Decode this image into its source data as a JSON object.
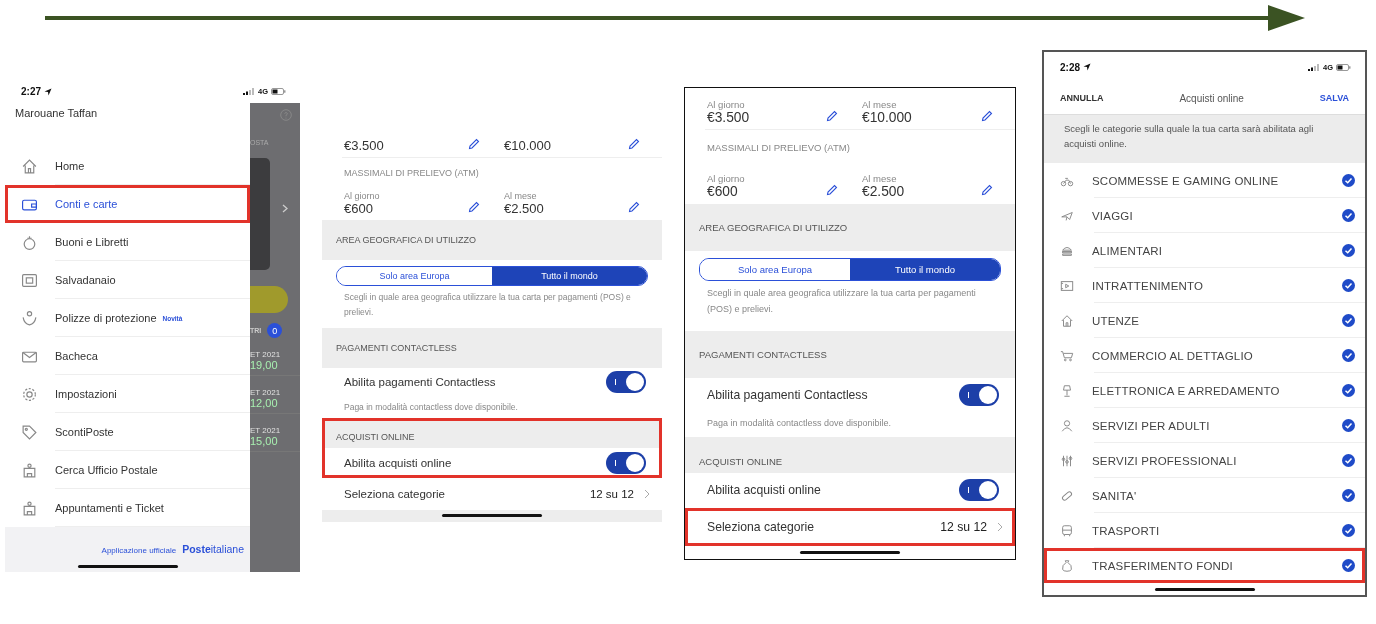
{
  "panels": [
    {
      "kind": "menu",
      "status_bar": {
        "time": "2:27",
        "network": "4G"
      },
      "user_name": "Marouane Taffan",
      "items": [
        {
          "label": "Home",
          "selected": false,
          "highlighted": false
        },
        {
          "label": "Conti e carte",
          "selected": true,
          "highlighted": true
        },
        {
          "label": "Buoni e Libretti",
          "selected": false,
          "highlighted": false
        },
        {
          "label": "Salvadanaio",
          "selected": false,
          "highlighted": false
        },
        {
          "label": "Polizze di protezione",
          "badge": "Novità",
          "selected": false,
          "highlighted": false
        },
        {
          "label": "Bacheca",
          "selected": false,
          "highlighted": false
        },
        {
          "label": "Impostazioni",
          "selected": false,
          "highlighted": false
        },
        {
          "label": "ScontiPoste",
          "selected": false,
          "highlighted": false
        },
        {
          "label": "Cerca Ufficio Postale",
          "selected": false,
          "highlighted": false
        },
        {
          "label": "Appuntamenti e Ticket",
          "selected": false,
          "highlighted": false
        }
      ],
      "footer": {
        "caption": "Applicazione ufficiale",
        "brand": "**Poste**italiane"
      },
      "background": {
        "tab": "OSTA",
        "filter": "TRI",
        "counter": "0",
        "entries": [
          {
            "date": "ET 2021",
            "amount": "19,00"
          },
          {
            "date": "ET 2021",
            "amount": "12,00"
          },
          {
            "date": "ET 2021",
            "amount": "15,00"
          }
        ]
      }
    },
    {
      "kind": "settings",
      "rows": [
        {
          "kind": "limits",
          "highlighted": false,
          "cells": [
            {
              "value": "€3.500"
            },
            {
              "value": "€10.000"
            }
          ]
        },
        {
          "kind": "caption",
          "highlighted": false,
          "text": "MASSIMALI DI PRELIEVO (ATM)"
        },
        {
          "kind": "limits",
          "highlighted": false,
          "cells": [
            {
              "label": "Al giorno",
              "value": "€600"
            },
            {
              "label": "Al mese",
              "value": "€2.500"
            }
          ]
        },
        {
          "kind": "header",
          "highlighted": false,
          "text": "AREA GEOGRAFICA DI UTILIZZO"
        },
        {
          "kind": "segmented",
          "highlighted": false,
          "options": [
            {
              "label": "Solo area Europa",
              "selected": false
            },
            {
              "label": "Tutto il mondo",
              "selected": true
            }
          ]
        },
        {
          "kind": "note",
          "highlighted": false,
          "text": "Scegli in quale area geografica utilizzare la tua carta per pagamenti (POS) e prelievi."
        },
        {
          "kind": "header",
          "highlighted": false,
          "text": "PAGAMENTI CONTACTLESS"
        },
        {
          "kind": "toggle",
          "highlighted": false,
          "label": "Abilita pagamenti Contactless",
          "on": true
        },
        {
          "kind": "note",
          "highlighted": false,
          "text": "Paga in modalità contactless dove disponibile."
        },
        {
          "kind": "header",
          "highlighted": true,
          "text": "ACQUISTI ONLINE"
        },
        {
          "kind": "toggle",
          "highlighted": true,
          "label": "Abilita acquisti online",
          "on": true
        },
        {
          "kind": "link",
          "highlighted": false,
          "label": "Seleziona categorie",
          "value": "12 su 12"
        }
      ]
    },
    {
      "kind": "settings",
      "rows": [
        {
          "kind": "limits",
          "highlighted": false,
          "cells": [
            {
              "label": "Al giorno",
              "value": "€3.500"
            },
            {
              "label": "Al mese",
              "value": "€10.000"
            }
          ]
        },
        {
          "kind": "caption",
          "highlighted": false,
          "text": "MASSIMALI DI PRELIEVO (ATM)"
        },
        {
          "kind": "limits",
          "highlighted": false,
          "cells": [
            {
              "label": "Al giorno",
              "value": "€600"
            },
            {
              "label": "Al mese",
              "value": "€2.500"
            }
          ]
        },
        {
          "kind": "header",
          "highlighted": false,
          "text": "AREA GEOGRAFICA DI UTILIZZO"
        },
        {
          "kind": "segmented",
          "highlighted": false,
          "options": [
            {
              "label": "Solo area Europa",
              "selected": false
            },
            {
              "label": "Tutto il mondo",
              "selected": true
            }
          ]
        },
        {
          "kind": "note",
          "highlighted": false,
          "text": "Scegli in quale area geografica utilizzare la tua carta per pagamenti (POS) e prelievi."
        },
        {
          "kind": "header",
          "highlighted": false,
          "text": "PAGAMENTI CONTACTLESS"
        },
        {
          "kind": "toggle",
          "highlighted": false,
          "label": "Abilita pagamenti Contactless",
          "on": true
        },
        {
          "kind": "note",
          "highlighted": false,
          "text": "Paga in modalità contactless dove disponibile."
        },
        {
          "kind": "header",
          "highlighted": false,
          "text": "ACQUISTI ONLINE"
        },
        {
          "kind": "toggle",
          "highlighted": false,
          "label": "Abilita acquisti online",
          "on": true
        },
        {
          "kind": "link",
          "highlighted": true,
          "label": "Seleziona categorie",
          "value": "12 su 12"
        }
      ]
    },
    {
      "kind": "categories",
      "status_bar": {
        "time": "2:28",
        "network": "4G"
      },
      "header": {
        "cancel": "ANNULLA",
        "title": "Acquisti online",
        "save": "SALVA"
      },
      "description": "Scegli le categorie sulla quale la tua carta sarà abilitata agli acquisti online.",
      "items": [
        {
          "label": "SCOMMESSE E GAMING ONLINE",
          "checked": true,
          "highlighted": false
        },
        {
          "label": "VIAGGI",
          "checked": true,
          "highlighted": false
        },
        {
          "label": "ALIMENTARI",
          "checked": true,
          "highlighted": false
        },
        {
          "label": "INTRATTENIMENTO",
          "checked": true,
          "highlighted": false
        },
        {
          "label": "UTENZE",
          "checked": true,
          "highlighted": false
        },
        {
          "label": "COMMERCIO AL DETTAGLIO",
          "checked": true,
          "highlighted": false
        },
        {
          "label": "ELETTRONICA E ARREDAMENTO",
          "checked": true,
          "highlighted": false
        },
        {
          "label": "SERVIZI PER ADULTI",
          "checked": true,
          "highlighted": false
        },
        {
          "label": "SERVIZI PROFESSIONALI",
          "checked": true,
          "highlighted": false
        },
        {
          "label": "SANITA'",
          "checked": true,
          "highlighted": false
        },
        {
          "label": "TRASPORTI",
          "checked": true,
          "highlighted": false
        },
        {
          "label": "TRASFERIMENTO FONDI",
          "checked": true,
          "highlighted": true
        }
      ]
    }
  ]
}
